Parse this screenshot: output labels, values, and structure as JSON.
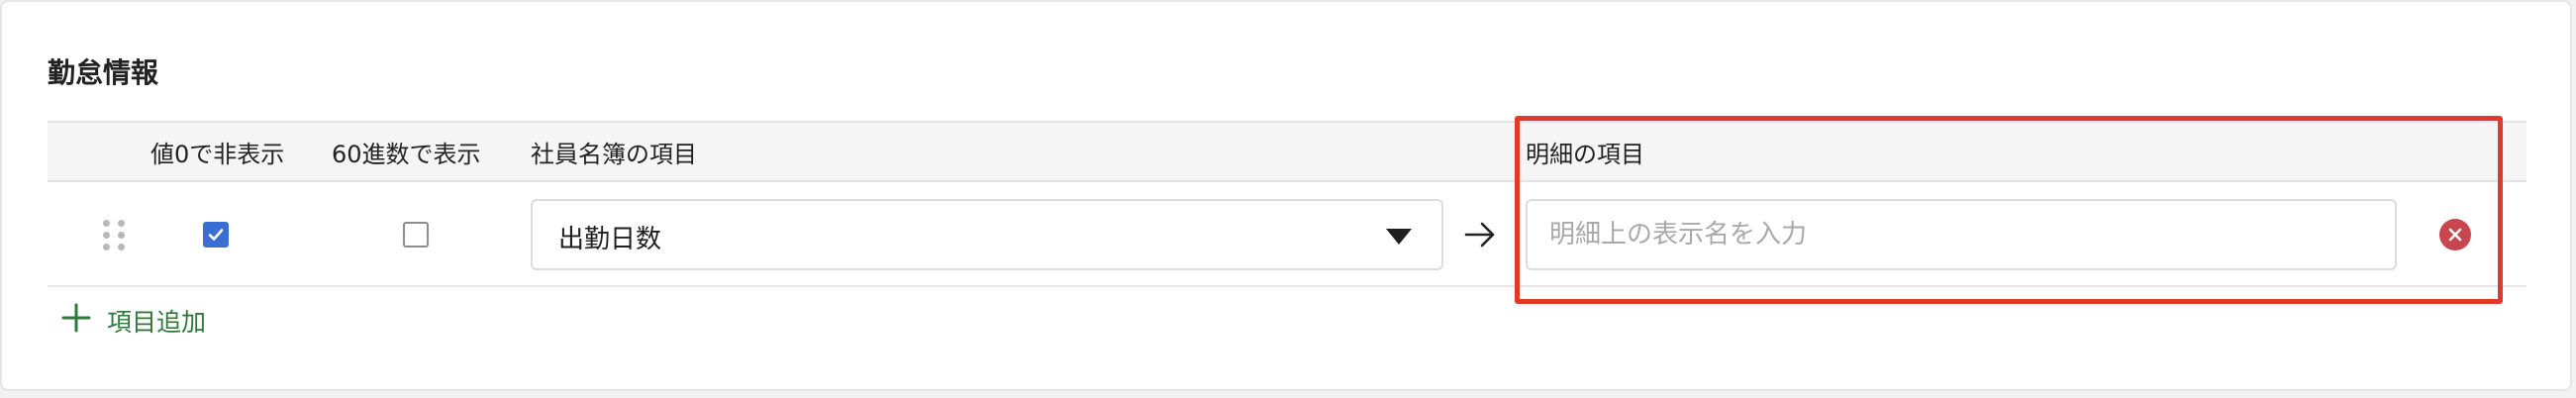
{
  "section": {
    "title": "勤怠情報"
  },
  "table": {
    "headers": {
      "hide_zero": "値0で非表示",
      "sexagesimal": "60進数で表示",
      "employee_field": "社員名簿の項目",
      "detail_field": "明細の項目"
    },
    "rows": [
      {
        "hide_zero_checked": true,
        "sexagesimal_checked": false,
        "employee_field_value": "出勤日数",
        "detail_field_value": "",
        "detail_field_placeholder": "明細上の表示名を入力"
      }
    ]
  },
  "actions": {
    "add_item_label": "項目追加"
  },
  "icons": {
    "drag": "drag-handle-icon",
    "caret": "caret-down-icon",
    "arrow": "arrow-right-icon",
    "remove": "remove-circle-icon",
    "add": "plus-icon"
  },
  "colors": {
    "checkbox_checked": "#3a6ed4",
    "remove_icon": "#c8474f",
    "highlight_border": "#e03a2a",
    "add_link": "#2f7a3a"
  }
}
